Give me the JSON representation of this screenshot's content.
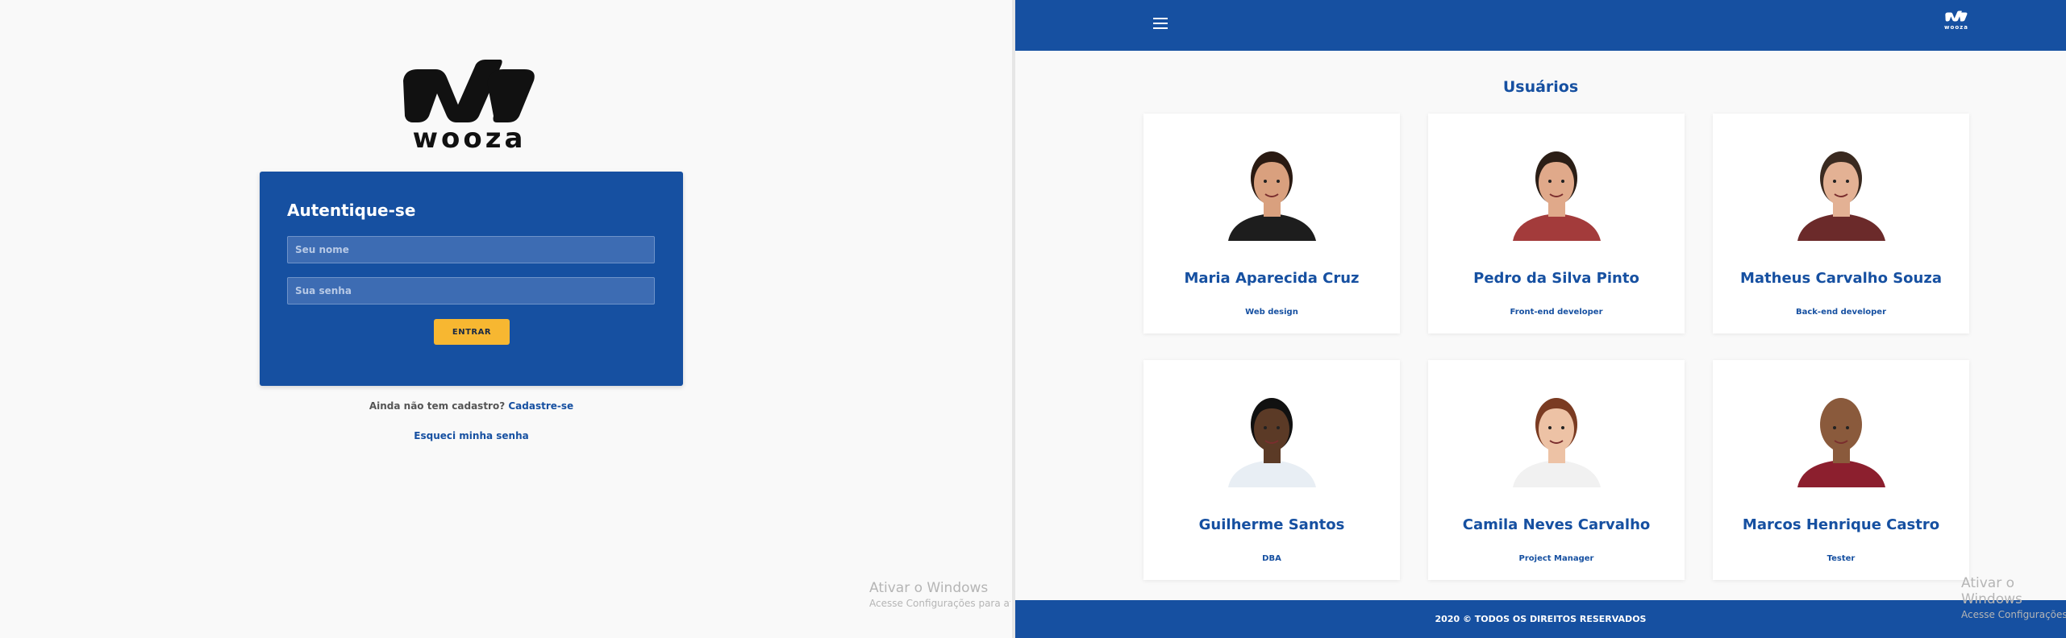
{
  "login": {
    "brand": "wooza",
    "title": "Autentique-se",
    "name_placeholder": "Seu nome",
    "password_placeholder": "Sua senha",
    "submit_label": "ENTRAR",
    "signup_prompt": "Ainda não tem cadastro?",
    "signup_link": "Cadastre-se",
    "forgot_link": "Esqueci minha senha"
  },
  "watermark": {
    "title": "Ativar o Windows",
    "subtitle": "Acesse Configurações para ativar o Windows.",
    "title_right": "Ativar o Windows",
    "subtitle_right": "Acesse Configurações"
  },
  "users_page": {
    "brand": "wooza",
    "section_title": "Usuários",
    "users": [
      {
        "name": "Maria Aparecida Cruz",
        "role": "Web design",
        "skin": "#d9a07e",
        "hair": "#2a1a12",
        "shirt": "#1d1d1d"
      },
      {
        "name": "Pedro da Silva Pinto",
        "role": "Front-end developer",
        "skin": "#e0a98a",
        "hair": "#2b1e16",
        "shirt": "#a33b3b"
      },
      {
        "name": "Matheus Carvalho Souza",
        "role": "Back-end developer",
        "skin": "#e3b194",
        "hair": "#3a2a20",
        "shirt": "#6b2a2a"
      },
      {
        "name": "Guilherme Santos",
        "role": "DBA",
        "skin": "#5b3a26",
        "hair": "#111111",
        "shirt": "#e8eef4"
      },
      {
        "name": "Camila Neves Carvalho",
        "role": "Project Manager",
        "skin": "#edc2a5",
        "hair": "#7a3b22",
        "shirt": "#f1f1f1"
      },
      {
        "name": "Marcos Henrique Castro",
        "role": "Tester",
        "skin": "#8a5a3c",
        "hair": "#8a5a3c",
        "shirt": "#8c1f2e"
      }
    ],
    "footer": "2020 © TODOS OS DIREITOS RESERVADOS"
  },
  "colors": {
    "primary": "#1650a1",
    "accent": "#f7b731",
    "background": "#f9f9f9"
  }
}
